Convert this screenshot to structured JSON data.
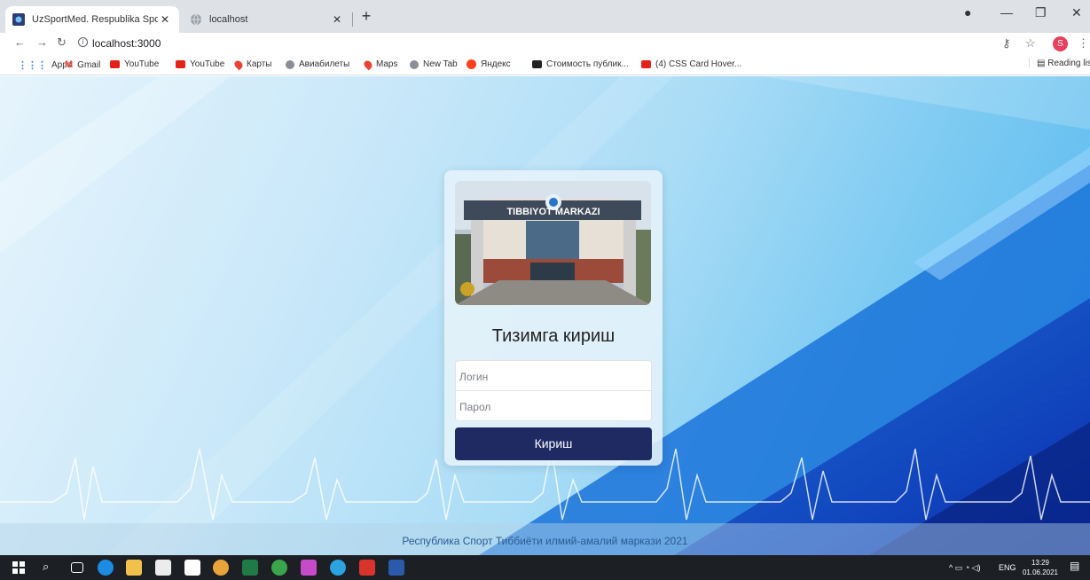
{
  "browser": {
    "tabs": [
      {
        "label": "UzSportMed. Respublika Sport ti",
        "active": true
      },
      {
        "label": "localhost",
        "active": false
      }
    ],
    "url": "localhost:3000",
    "profile_initial": "S",
    "bookmarks": [
      {
        "label": "Apps",
        "icon": "apps-grid-icon"
      },
      {
        "label": "Gmail",
        "icon": "gmail-icon"
      },
      {
        "label": "YouTube",
        "icon": "youtube-icon"
      },
      {
        "label": "YouTube",
        "icon": "youtube-icon"
      },
      {
        "label": "Карты",
        "icon": "maps-pin-icon"
      },
      {
        "label": "Авиабилеты",
        "icon": "globe-icon"
      },
      {
        "label": "Maps",
        "icon": "maps-pin-icon"
      },
      {
        "label": "New Tab",
        "icon": "globe-icon"
      },
      {
        "label": "Яндекс",
        "icon": "yandex-icon"
      },
      {
        "label": "Стоимость публик...",
        "icon": "mh-icon"
      },
      {
        "label": "(4) CSS Card Hover...",
        "icon": "youtube-icon"
      }
    ],
    "reading_list": "Reading list"
  },
  "login": {
    "photo_sign": "TIBBIYOT MARKAZI",
    "title": "Тизимга кириш",
    "login_placeholder": "Логин",
    "password_placeholder": "Парол",
    "submit_label": "Кириш"
  },
  "footer": {
    "text": "Республика Спорт Тиббиёти илмий-амалий маркази 2021"
  },
  "taskbar": {
    "language": "ENG",
    "time": "13:29",
    "date": "01.06.2021"
  },
  "colors": {
    "button_bg": "#1f2a63",
    "footer_text": "#2b5a92",
    "background_blue": "#4fb6ee"
  }
}
